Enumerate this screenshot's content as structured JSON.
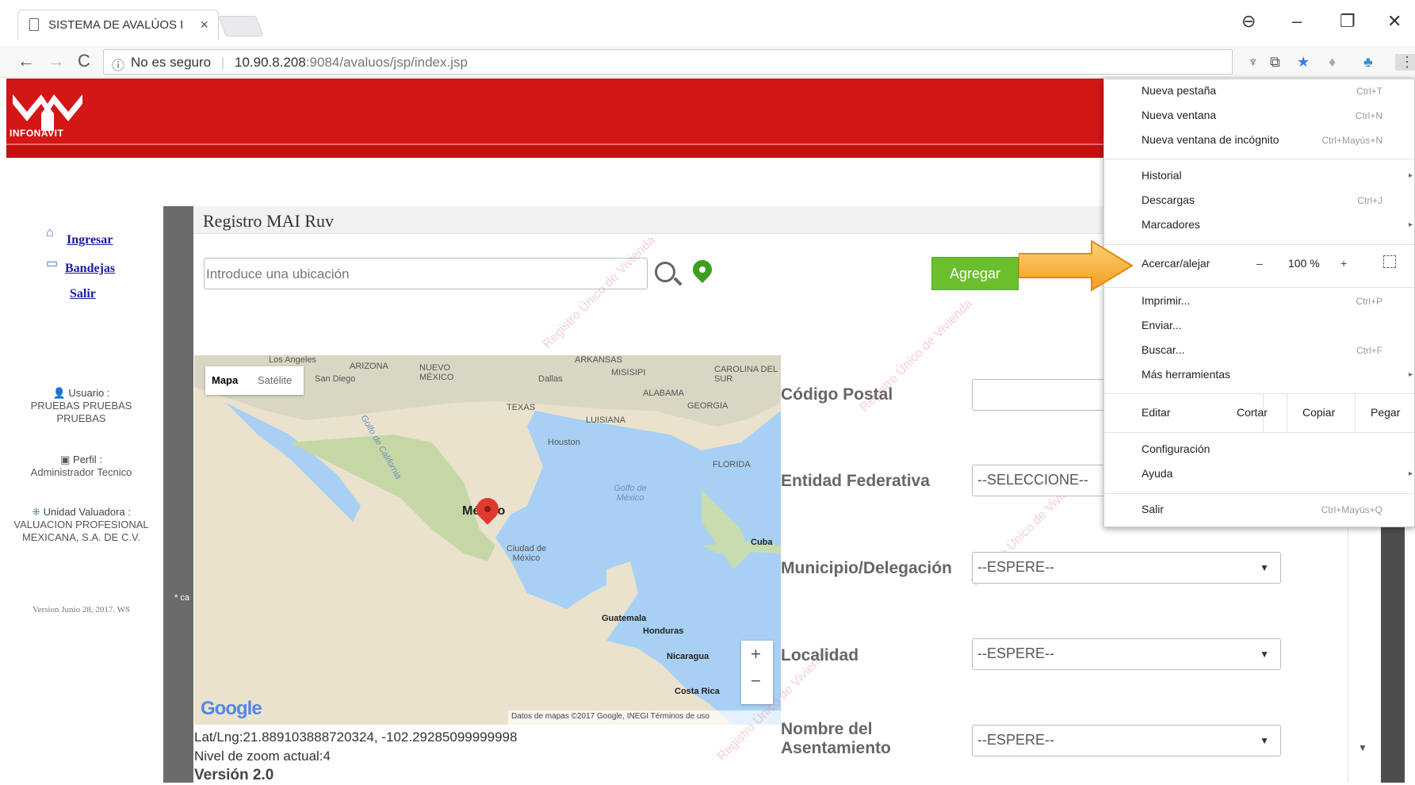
{
  "browser": {
    "tab_title": "SISTEMA DE AVALÚOS I",
    "tab_close": "×",
    "security": "No es seguro",
    "url_host": "10.90.8.208",
    "url_path": ":9084/avaluos/jsp/index.jsp",
    "window_controls": {
      "minimize": "–",
      "restore": "❐",
      "close": "✕"
    },
    "nav": {
      "back": "←",
      "forward": "→",
      "reload": "C"
    }
  },
  "header": {
    "logo_text": "INFONAVIT",
    "colors": {
      "header_red": "#d31616",
      "accent_green": "#6bbf2c"
    }
  },
  "leftnav": {
    "links": [
      {
        "label": "Ingresar",
        "icon": "home-icon"
      },
      {
        "label": "Bandejas",
        "icon": "tray-icon"
      },
      {
        "label": "Salir"
      }
    ],
    "usuario_label": "Usuario :",
    "usuario_value": "PRUEBAS PRUEBAS PRUEBAS",
    "perfil_label": "Perfil :",
    "perfil_value": "Administrador Tecnico",
    "unidad_label": "Unidad Valuadora :",
    "unidad_value": "VALUACION PROFESIONAL MEXICANA, S.A. DE C.V.",
    "version": "Version Junio 28, 2017. WS",
    "asterisk_text": "* ca"
  },
  "main": {
    "title": "Registro MAI Ruv",
    "search_placeholder": "Introduce una ubicación",
    "add_button": "Agregar",
    "map": {
      "type_map": "Mapa",
      "type_satellite": "Satélite",
      "zoom_in": "+",
      "zoom_out": "−",
      "google": "Google",
      "credits": "Datos de mapas ©2017 Google, INEGI    Términos de uso",
      "labels": {
        "los_angeles": "Los Angeles",
        "san_diego": "San Diego",
        "arizona": "ARIZONA",
        "nuevo_mexico": "NUEVO MÉXICO",
        "arkansas": "ARKANSAS",
        "dallas": "Dallas",
        "mississippi": "MISISIPI",
        "carolina": "CAROLINA DEL SUR",
        "alabama": "ALABAMA",
        "georgia": "GEORGIA",
        "texas": "TEXAS",
        "louisiana": "LUISIANA",
        "houston": "Houston",
        "florida": "FLORIDA",
        "golfo_cal": "Golfo de California",
        "golfo_mex": "Golfo de México",
        "mexico": "México",
        "cdmx": "Ciudad de México",
        "cuba": "Cuba",
        "guatemala": "Guatemala",
        "honduras": "Honduras",
        "nicaragua": "Nicaragua",
        "costa_rica": "Costa Rica"
      }
    },
    "latlng": "Lat/Lng:21.889103888720324, -102.29285099999998",
    "zoom_text": "Nivel de zoom actual:4",
    "version": "Versión 2.0"
  },
  "form": {
    "codigo_postal_label": "Código Postal",
    "codigo_postal_value": "",
    "entidad_label": "Entidad Federativa",
    "entidad_value": "--SELECCIONE--",
    "municipio_label": "Municipio/Delegación",
    "municipio_value": "--ESPERE--",
    "localidad_label": "Localidad",
    "localidad_value": "--ESPERE--",
    "asentamiento_label_1": "Nombre del",
    "asentamiento_label_2": "Asentamiento",
    "asentamiento_value": "--ESPERE--",
    "select_caret": "▼",
    "watermark": "Registro Único de Vivienda"
  },
  "chrome_menu": {
    "items": [
      {
        "label": "Nueva pestaña",
        "shortcut": "Ctrl+T"
      },
      {
        "label": "Nueva ventana",
        "shortcut": "Ctrl+N"
      },
      {
        "label": "Nueva ventana de incógnito",
        "shortcut": "Ctrl+Mayús+N"
      },
      {
        "label": "Historial",
        "arrow": "▸"
      },
      {
        "label": "Descargas",
        "shortcut": "Ctrl+J"
      },
      {
        "label": "Marcadores",
        "arrow": "▸"
      },
      {
        "label": "Acercar/alejar"
      },
      {
        "label": "Imprimir...",
        "shortcut": "Ctrl+P"
      },
      {
        "label": "Enviar..."
      },
      {
        "label": "Buscar...",
        "shortcut": "Ctrl+F"
      },
      {
        "label": "Más herramientas",
        "arrow": "▸"
      },
      {
        "label": "Editar"
      },
      {
        "label": "Configuración"
      },
      {
        "label": "Ayuda",
        "arrow": "▸"
      },
      {
        "label": "Salir",
        "shortcut": "Ctrl+Mayús+Q"
      }
    ],
    "zoom": {
      "minus": "–",
      "value": "100 %",
      "plus": "+"
    },
    "edit": {
      "cut": "Cortar",
      "copy": "Copiar",
      "paste": "Pegar"
    }
  }
}
